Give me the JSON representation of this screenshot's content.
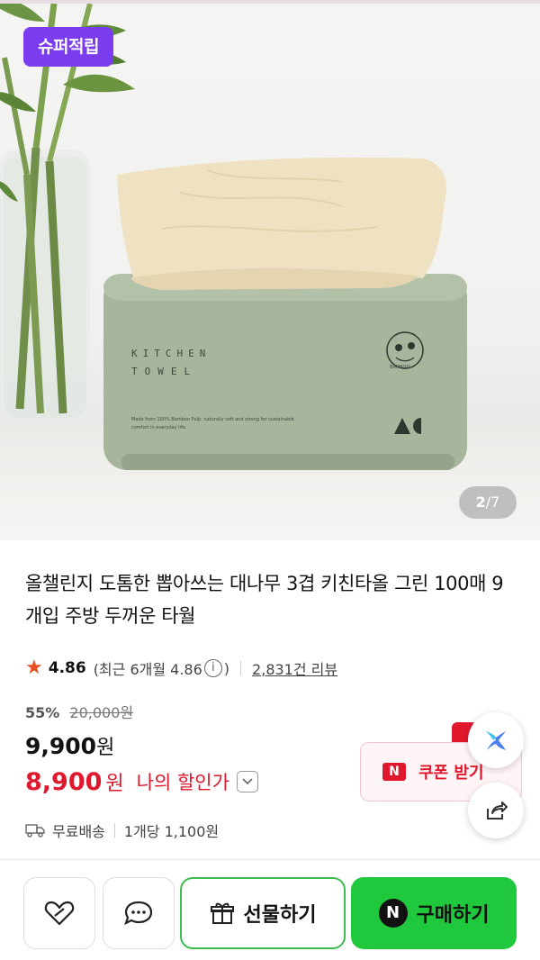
{
  "hero": {
    "badge": "슈퍼적립",
    "box_line1": "KITCHEN",
    "box_line2": "TOWEL",
    "box_small": "Made from 100% Bamboo Pulp. naturally soft and strong for sustainable comfort in everyday life.",
    "box_logo": "BAMBOO",
    "box_brand": "AC",
    "counter_current": "2",
    "counter_total": "/7"
  },
  "product": {
    "title": "올챌린지 도톰한 뽑아쓰는 대나무 3겹 키친타올 그린 100매 9개입 주방 두꺼운 타월",
    "rating": "4.86",
    "recent_prefix": "(최근 6개월 4.86",
    "recent_suffix": ")",
    "reviews": "2,831건 리뷰",
    "discount_pct": "55%",
    "original_price": "20,000원",
    "price": "9,900",
    "price_unit": "원",
    "my_price": "8,900",
    "my_price_unit": "원",
    "my_price_label": "나의 할인가",
    "shipping": "무료배송",
    "unit_price": "1개당 1,100원"
  },
  "coupon": {
    "n": "N",
    "label": "쿠폰 받기"
  },
  "actions": {
    "gift": "선물하기",
    "buy_n": "N",
    "buy": "구매하기"
  },
  "icons": {
    "like": "heart-icon",
    "chat": "chat-icon",
    "gift": "gift-icon",
    "share": "share-icon",
    "ai": "ai-sparkle-icon",
    "delivery": "truck-icon",
    "star": "star-icon",
    "info": "info-icon",
    "chevron": "chevron-down-icon"
  },
  "colors": {
    "badge": "#7b3cf0",
    "sale_red": "#e0182d",
    "buy_green": "#1fc83c",
    "star": "#e85023",
    "box_green": "#a7b59d"
  }
}
